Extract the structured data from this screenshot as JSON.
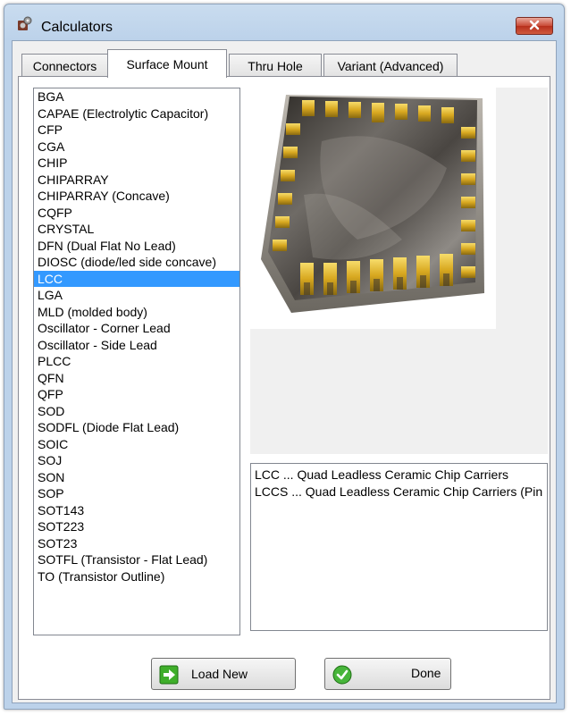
{
  "window": {
    "title": "Calculators",
    "app_icon": "chip-cog-icon",
    "close_icon": "close-icon"
  },
  "tabs": [
    {
      "label": "Connectors",
      "active": false
    },
    {
      "label": "Surface Mount",
      "active": true
    },
    {
      "label": "Thru Hole",
      "active": false
    },
    {
      "label": "Variant (Advanced)",
      "active": false
    }
  ],
  "package_list": {
    "selected": "LCC",
    "items": [
      "BGA",
      "CAPAE (Electrolytic Capacitor)",
      "CFP",
      "CGA",
      "CHIP",
      "CHIPARRAY",
      "CHIPARRAY (Concave)",
      "CQFP",
      "CRYSTAL",
      "DFN (Dual Flat No Lead)",
      "DIOSC (diode/led side concave)",
      "LCC",
      "LGA",
      "MLD (molded body)",
      "Oscillator - Corner Lead",
      "Oscillator - Side Lead",
      "PLCC",
      "QFN",
      "QFP",
      "SOD",
      "SODFL (Diode Flat Lead)",
      "SOIC",
      "SOJ",
      "SON",
      "SOP",
      "SOT143",
      "SOT223",
      "SOT23",
      "SOTFL (Transistor - Flat Lead)",
      "TO (Transistor Outline)"
    ]
  },
  "preview": {
    "image": "lcc-chip-package-image"
  },
  "descriptions": [
    "LCC ... Quad Leadless Ceramic Chip Carriers",
    "LCCS ... Quad Leadless Ceramic Chip Carriers (Pin"
  ],
  "buttons": {
    "load_new": {
      "label": "Load New",
      "icon": "green-arrow-right-icon"
    },
    "done": {
      "label": "Done",
      "icon": "green-check-icon"
    }
  },
  "colors": {
    "selection": "#3399ff",
    "title_bar": "#bcd2ea",
    "close": "#c94a36",
    "gold": "#d8a820"
  }
}
